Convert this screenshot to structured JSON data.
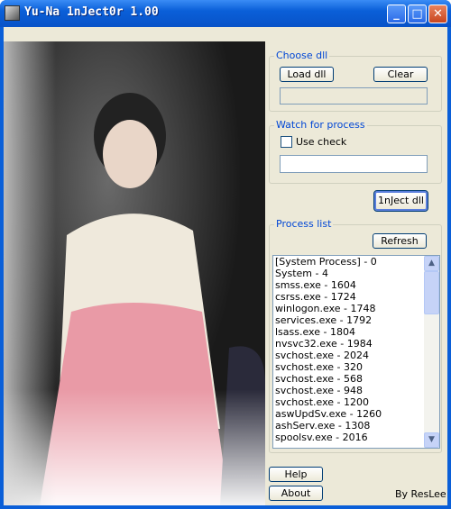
{
  "window": {
    "title": "Yu-Na 1nJect0r 1.00",
    "minimize": "_",
    "maximize": "□",
    "close": "✕"
  },
  "choose_dll": {
    "legend": "Choose dll",
    "load": "Load dll",
    "clear": "Clear",
    "path": ""
  },
  "watch": {
    "legend": "Watch for process",
    "use_check": "Use check",
    "checked": false,
    "process": ""
  },
  "inject": "1nJect dll",
  "process_list": {
    "legend": "Process list",
    "refresh": "Refresh",
    "items": [
      "[System Process] - 0",
      "System - 4",
      "smss.exe - 1604",
      "csrss.exe - 1724",
      "winlogon.exe - 1748",
      "services.exe - 1792",
      "lsass.exe - 1804",
      "nvsvc32.exe - 1984",
      "svchost.exe - 2024",
      "svchost.exe - 320",
      "svchost.exe - 568",
      "svchost.exe - 948",
      "svchost.exe - 1200",
      "aswUpdSv.exe - 1260",
      "ashServ.exe - 1308",
      "spoolsv.exe - 2016"
    ]
  },
  "footer": {
    "help": "Help",
    "about": "About",
    "credit": "By ResLee"
  }
}
